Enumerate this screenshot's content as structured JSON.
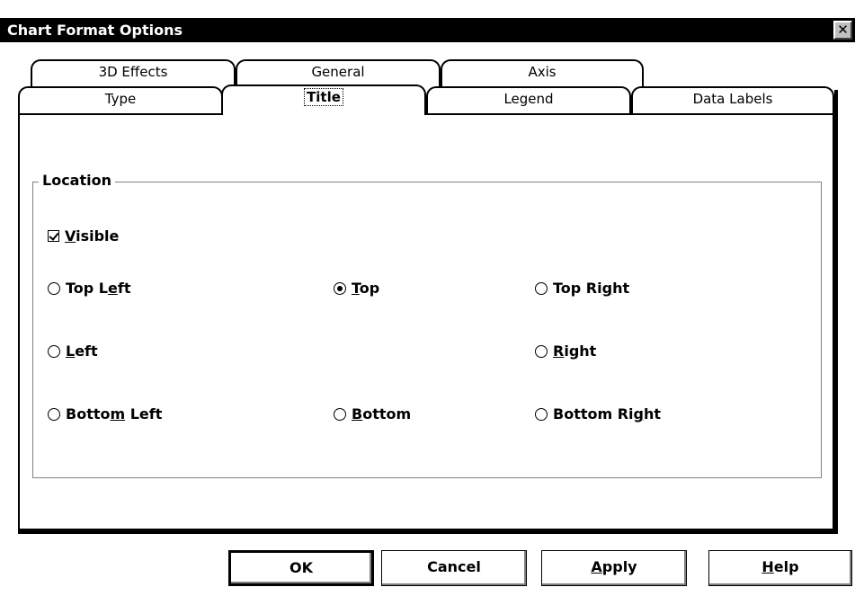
{
  "window": {
    "title": "Chart Format Options",
    "close_symbol": "✕"
  },
  "tabs_back_row": [
    {
      "label": "3D Effects"
    },
    {
      "label": "General"
    },
    {
      "label": "Axis"
    }
  ],
  "tabs_front_row": [
    {
      "label": "Type"
    },
    {
      "label": "Title",
      "active": true
    },
    {
      "label": "Legend"
    },
    {
      "label": "Data Labels"
    }
  ],
  "location_group": {
    "label": "Location",
    "visible_checkbox": {
      "pre": "",
      "key": "V",
      "post": "isible",
      "checked": true
    },
    "positions": {
      "top_left": {
        "pre": "Top L",
        "key": "e",
        "post": "ft",
        "selected": false
      },
      "top": {
        "pre": "",
        "key": "T",
        "post": "op",
        "selected": true
      },
      "top_right": {
        "pre": "Top Ri",
        "key": "g",
        "post": "ht",
        "selected": false
      },
      "left": {
        "pre": "",
        "key": "L",
        "post": "eft",
        "selected": false
      },
      "right": {
        "pre": "",
        "key": "R",
        "post": "ight",
        "selected": false
      },
      "bottom_left": {
        "pre": "Botto",
        "key": "m",
        "post": " Left",
        "selected": false
      },
      "bottom": {
        "pre": "",
        "key": "B",
        "post": "ottom",
        "selected": false
      },
      "bottom_right": {
        "pre": "Bottom Ri",
        "key": "g",
        "post": "ht",
        "selected": false
      }
    }
  },
  "buttons": {
    "ok": {
      "pre": "OK",
      "key": "",
      "post": ""
    },
    "cancel": {
      "pre": "Cancel",
      "key": "",
      "post": ""
    },
    "apply": {
      "pre": "",
      "key": "A",
      "post": "pply"
    },
    "help": {
      "pre": "",
      "key": "H",
      "post": "elp"
    }
  }
}
